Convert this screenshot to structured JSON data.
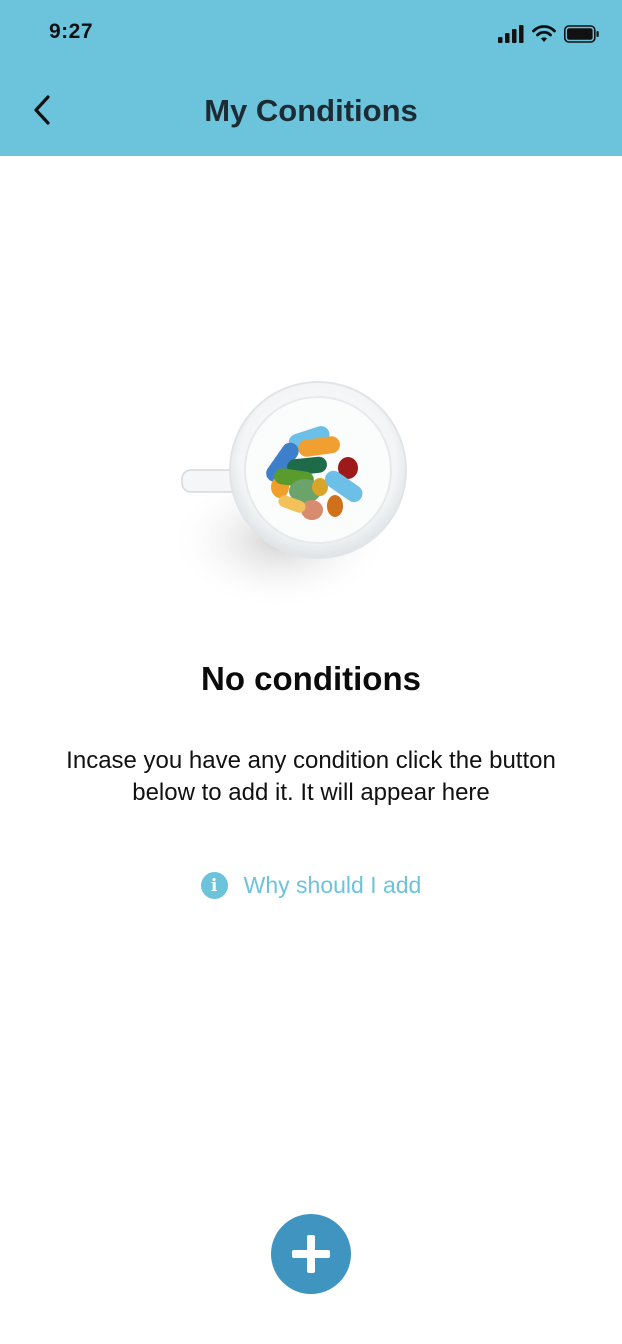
{
  "status_bar": {
    "time": "9:27"
  },
  "header": {
    "title": "My Conditions",
    "back_icon": "chevron-left-icon"
  },
  "empty_state": {
    "illustration": "cup-of-pills",
    "title": "No conditions",
    "description": "Incase you have any condition click the button below to add it. It will appear here",
    "info_link_label": "Why should I add",
    "info_icon": "info-icon"
  },
  "fab": {
    "icon": "plus-icon"
  },
  "colors": {
    "header_bg": "#6cc3dc",
    "accent": "#6cc3dc",
    "fab_bg": "#3f95bf"
  }
}
